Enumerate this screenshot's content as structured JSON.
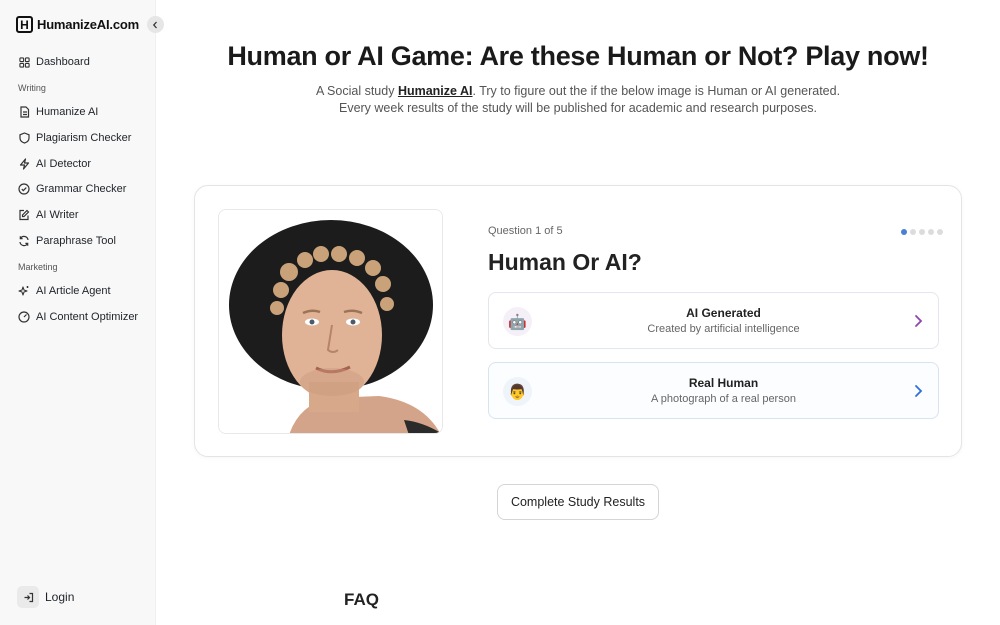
{
  "brand": {
    "logo_letter": "H",
    "name": "HumanizeAI.com"
  },
  "sidebar": {
    "dashboard": {
      "label": "Dashboard",
      "icon": "grid-icon"
    },
    "sections": [
      {
        "title": "Writing"
      },
      {
        "title": "Marketing"
      }
    ],
    "items": [
      {
        "label": "Humanize AI",
        "icon": "document-icon"
      },
      {
        "label": "Plagiarism Checker",
        "icon": "shield-icon"
      },
      {
        "label": "AI Detector",
        "icon": "zap-icon"
      },
      {
        "label": "Grammar Checker",
        "icon": "check-circle-icon"
      },
      {
        "label": "AI Writer",
        "icon": "edit-icon"
      },
      {
        "label": "Paraphrase Tool",
        "icon": "refresh-icon"
      },
      {
        "label": "AI Article Agent",
        "icon": "sparkles-icon"
      },
      {
        "label": "AI Content Optimizer",
        "icon": "gauge-icon"
      }
    ],
    "login": {
      "label": "Login",
      "icon": "login-icon"
    }
  },
  "main": {
    "title": "Human or AI Game: Are these Human or Not? Play now!",
    "subtitle_before": "A Social study ",
    "subtitle_link": "Humanize AI",
    "subtitle_after": ". Try to figure out the if the below image is Human or AI generated. Every week results of the study will be published for academic and research purposes."
  },
  "quiz": {
    "question_counter": "Question 1 of 5",
    "current_question": 1,
    "total_questions": 5,
    "question": "Human Or AI?",
    "options": [
      {
        "emoji": "🤖",
        "title": "AI Generated",
        "description": "Created by artificial intelligence",
        "chevron_color": "#8e44ad"
      },
      {
        "emoji": "👨",
        "title": "Real Human",
        "description": "A photograph of a real person",
        "chevron_color": "#2f6fd6"
      }
    ]
  },
  "results_button": "Complete Study Results",
  "faq_heading": "FAQ",
  "colors": {
    "accent_blue": "#4a7fd6",
    "sidebar_bg": "#f8f8f8"
  }
}
